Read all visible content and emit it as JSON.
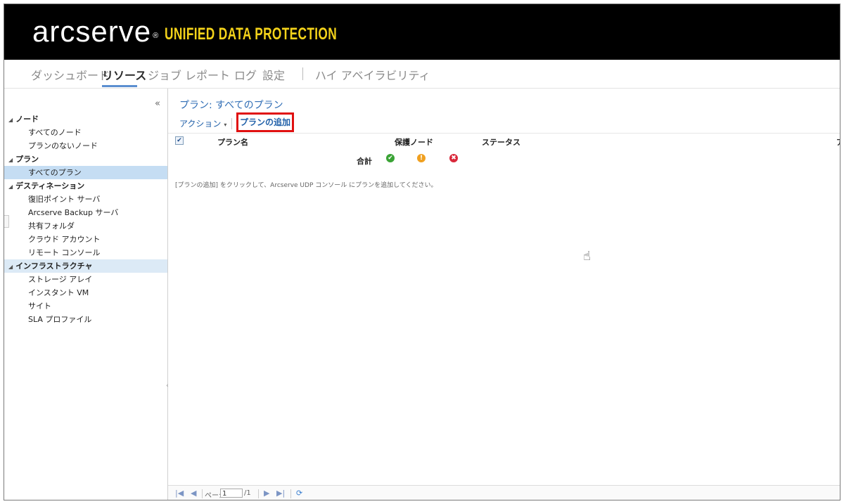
{
  "header": {
    "brand": "arcserve",
    "brand_mark": "®",
    "product": "UNIFIED DATA PROTECTION"
  },
  "nav": {
    "items": [
      {
        "label": "ダッシュボード",
        "active": false
      },
      {
        "label": "リソース",
        "active": true
      },
      {
        "label": "ジョブ",
        "active": false
      },
      {
        "label": "レポート",
        "active": false
      },
      {
        "label": "ログ",
        "active": false
      },
      {
        "label": "設定",
        "active": false
      },
      {
        "label": "ハイ アベイラビリティ",
        "active": false
      }
    ]
  },
  "sidebar": {
    "collapse_icon": "«",
    "groups": [
      {
        "label": "ノード",
        "children": [
          "すべてのノード",
          "プランのないノード"
        ]
      },
      {
        "label": "プラン",
        "children": [
          "すべてのプラン"
        ],
        "selected_child": 0
      },
      {
        "label": "デスティネーション",
        "children": [
          "復旧ポイント サーバ",
          "Arcserve Backup サーバ",
          "共有フォルダ",
          "クラウド アカウント",
          "リモート コンソール"
        ]
      },
      {
        "label": "インフラストラクチャ",
        "children": [
          "ストレージ アレイ",
          "インスタント VM",
          "サイト",
          "SLA プロファイル"
        ],
        "highlighted": true
      }
    ]
  },
  "main": {
    "breadcrumb": "プラン: すべてのプラン",
    "toolbar": {
      "action_label": "アクション",
      "add_plan_label": "プランの追加"
    },
    "columns": {
      "plan_name": "プラン名",
      "protected_nodes": "保護ノード",
      "status": "ステータス",
      "cut_off": "ア"
    },
    "total_label": "合計",
    "status_icons": [
      {
        "name": "success-icon",
        "glyph": "✔",
        "color": "#3aa335"
      },
      {
        "name": "warning-icon",
        "glyph": "!",
        "color": "#f0a020"
      },
      {
        "name": "error-icon",
        "glyph": "✖",
        "color": "#d9283a"
      }
    ],
    "hint": "[プランの追加] をクリックして、Arcserve UDP コンソール にプランを追加してください。"
  },
  "pager": {
    "page_label": "ページ",
    "page_value": "1",
    "page_total": "/1"
  },
  "colors": {
    "header_bg": "#000000",
    "product_yellow": "#f3d21a",
    "link_blue": "#2f6db5",
    "selected_row": "#c5ddf3",
    "highlight_box": "#e01010"
  }
}
